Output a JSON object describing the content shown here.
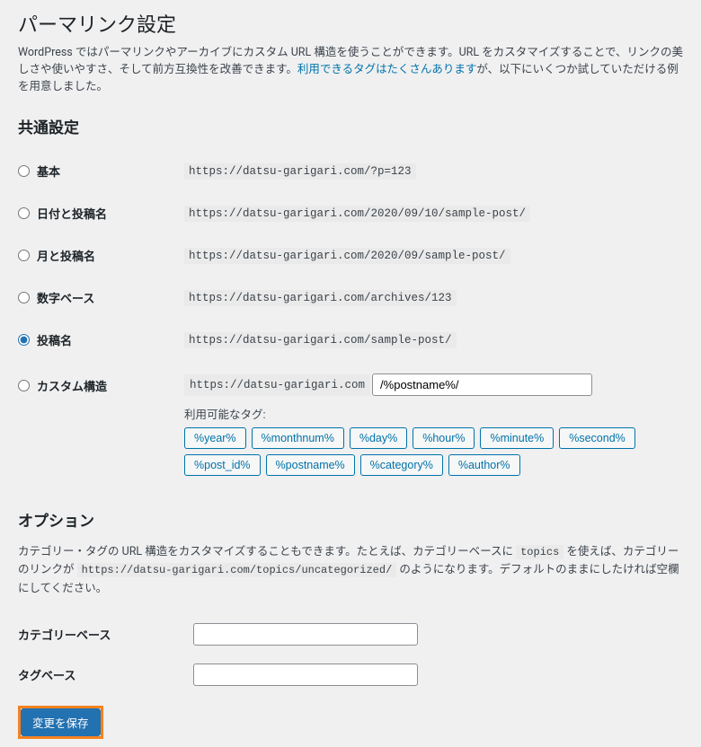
{
  "page_title": "パーマリンク設定",
  "description_prefix": "WordPress ではパーマリンクやアーカイブにカスタム URL 構造を使うことができます。URL をカスタマイズすることで、リンクの美しさや使いやすさ、そして前方互換性を改善できます。",
  "description_link": "利用できるタグはたくさんあります",
  "description_suffix": "が、以下にいくつか試していただける例を用意しました。",
  "section_common": "共通設定",
  "options": {
    "basic": {
      "label": "基本",
      "example": "https://datsu-garigari.com/?p=123"
    },
    "date_post": {
      "label": "日付と投稿名",
      "example": "https://datsu-garigari.com/2020/09/10/sample-post/"
    },
    "month_post": {
      "label": "月と投稿名",
      "example": "https://datsu-garigari.com/2020/09/sample-post/"
    },
    "numeric": {
      "label": "数字ベース",
      "example": "https://datsu-garigari.com/archives/123"
    },
    "postname": {
      "label": "投稿名",
      "example": "https://datsu-garigari.com/sample-post/"
    },
    "custom": {
      "label": "カスタム構造",
      "prefix": "https://datsu-garigari.com",
      "value": "/%postname%/"
    }
  },
  "tags_label": "利用可能なタグ:",
  "tags": [
    "%year%",
    "%monthnum%",
    "%day%",
    "%hour%",
    "%minute%",
    "%second%",
    "%post_id%",
    "%postname%",
    "%category%",
    "%author%"
  ],
  "section_option": "オプション",
  "option_desc_1": "カテゴリー・タグの URL 構造をカスタマイズすることもできます。たとえば、カテゴリーベースに ",
  "option_desc_code1": "topics",
  "option_desc_2": " を使えば、カテゴリーのリンクが ",
  "option_desc_code2": "https://datsu-garigari.com/topics/uncategorized/",
  "option_desc_3": " のようになります。デフォルトのままにしたければ空欄にしてください。",
  "category_base_label": "カテゴリーベース",
  "tag_base_label": "タグベース",
  "submit_label": "変更を保存"
}
